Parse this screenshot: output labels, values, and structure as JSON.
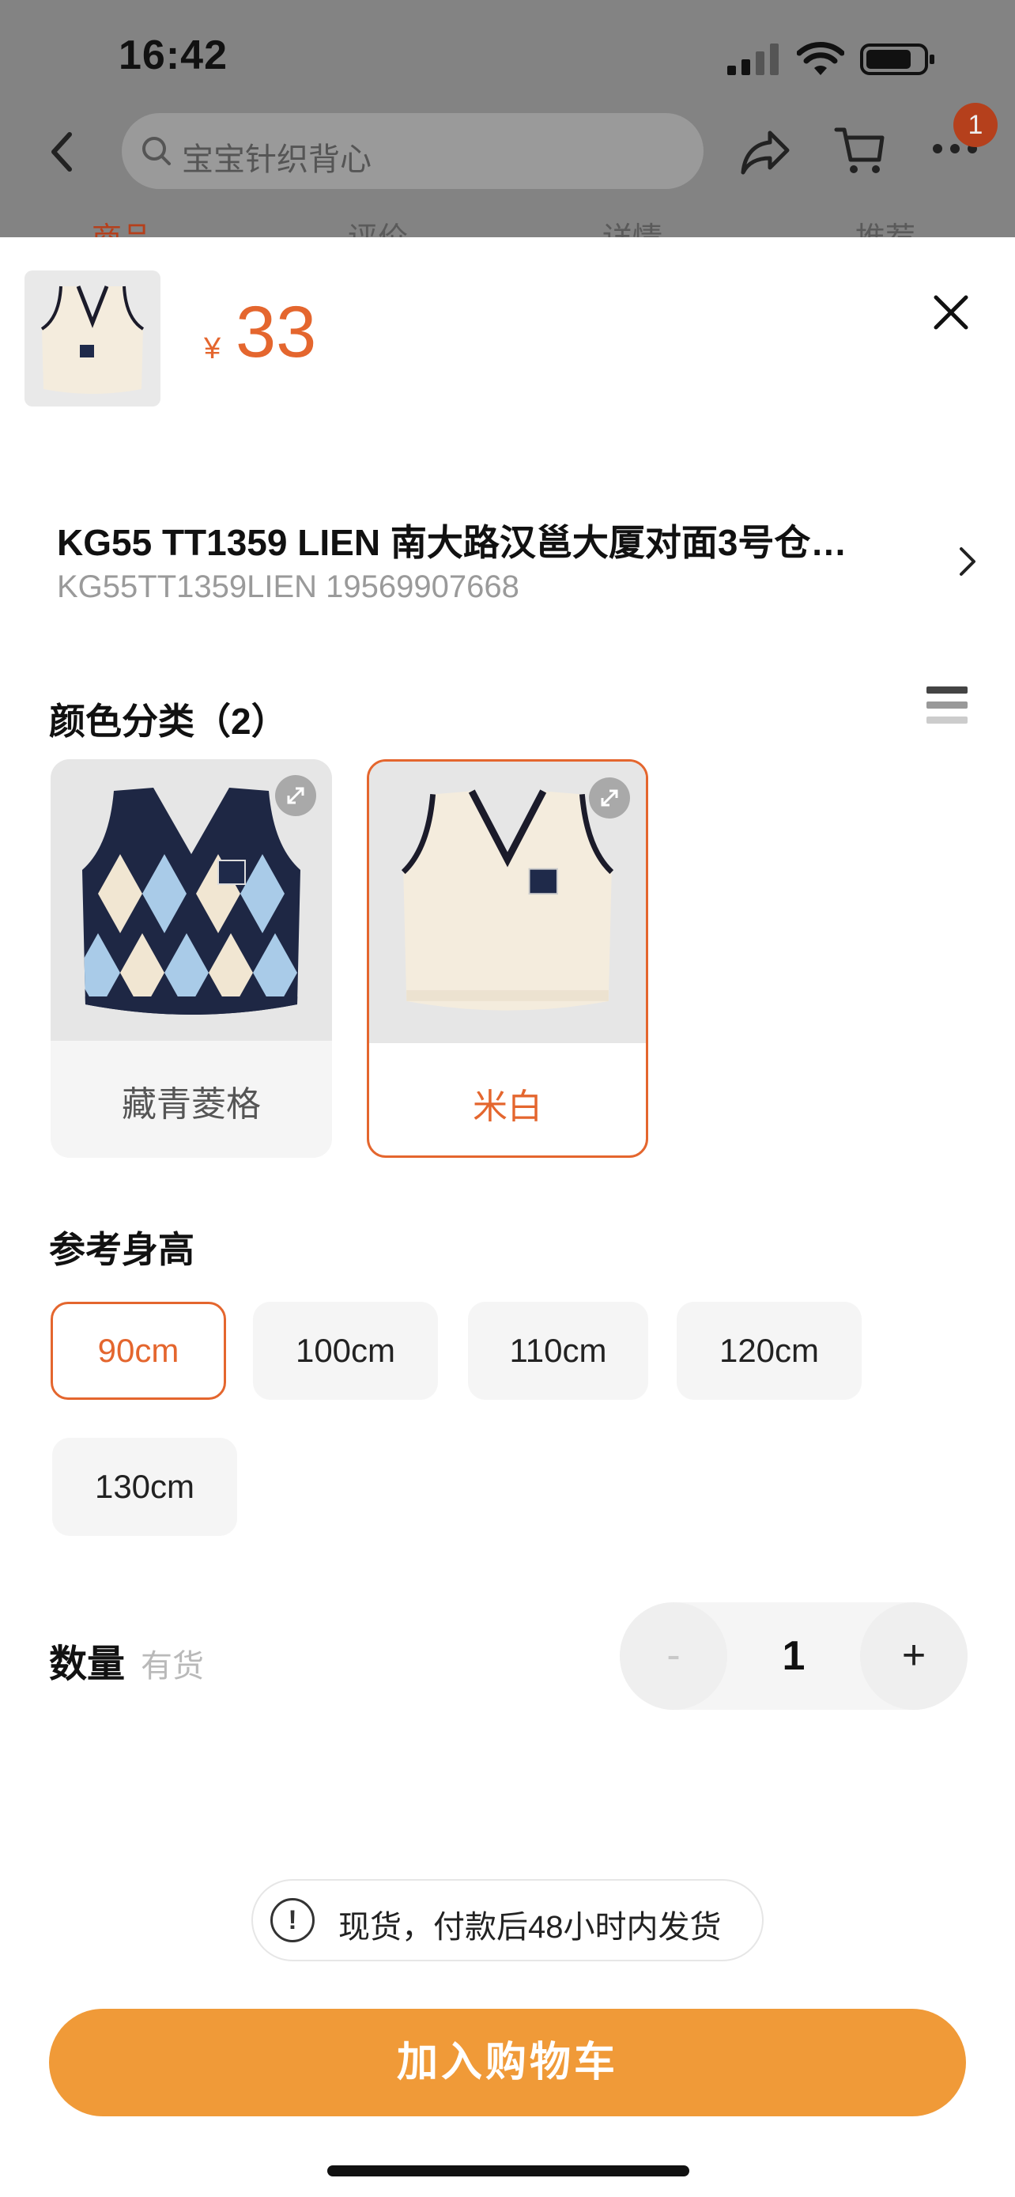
{
  "status_bar": {
    "time": "16:42"
  },
  "header": {
    "search_placeholder": "宝宝针织背心",
    "cart_badge": "1",
    "tabs_peek": [
      "商品",
      "评价",
      "详情",
      "推荐"
    ]
  },
  "sheet": {
    "price_symbol": "¥",
    "price": "33",
    "store": {
      "name": "KG55 TT1359 LIEN  南大路汉邕大厦对面3号仓…",
      "sub": "KG55TT1359LIEN 19569907668"
    },
    "color_section": {
      "title": "颜色分类（2）",
      "options": [
        {
          "label": "藏青菱格",
          "selected": false
        },
        {
          "label": "米白",
          "selected": true
        }
      ]
    },
    "size_section": {
      "title": "参考身高",
      "options": [
        {
          "label": "90cm",
          "selected": true
        },
        {
          "label": "100cm",
          "selected": false
        },
        {
          "label": "110cm",
          "selected": false
        },
        {
          "label": "120cm",
          "selected": false
        },
        {
          "label": "130cm",
          "selected": false
        }
      ]
    },
    "quantity": {
      "label": "数量",
      "stock": "有货",
      "minus": "-",
      "value": "1",
      "plus": "+"
    },
    "notice": {
      "icon": "!",
      "text": "现货，付款后48小时内发货"
    },
    "add_to_cart": "加入购物车"
  },
  "colors": {
    "accent": "#e4662e",
    "button": "#f09a38"
  }
}
